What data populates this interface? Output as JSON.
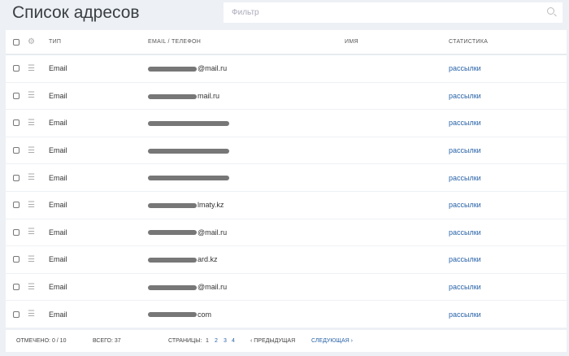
{
  "title": "Список адресов",
  "filter": {
    "placeholder": "Фильтр"
  },
  "columns": {
    "type": "ТИП",
    "email": "EMAIL / ТЕЛЕФОН",
    "name": "ИМЯ",
    "stats": "СТАТИСТИКА"
  },
  "rows": [
    {
      "type": "Email",
      "email": "@mail.ru",
      "stats": "рассылки"
    },
    {
      "type": "Email",
      "email": "mail.ru",
      "stats": "рассылки"
    },
    {
      "type": "Email",
      "email": "",
      "stats": "рассылки"
    },
    {
      "type": "Email",
      "email": "",
      "stats": "рассылки"
    },
    {
      "type": "Email",
      "email": "",
      "stats": "рассылки"
    },
    {
      "type": "Email",
      "email": "lmaty.kz",
      "stats": "рассылки"
    },
    {
      "type": "Email",
      "email": "@mail.ru",
      "stats": "рассылки"
    },
    {
      "type": "Email",
      "email": "ard.kz",
      "stats": "рассылки"
    },
    {
      "type": "Email",
      "email": "@mail.ru",
      "stats": "рассылки"
    },
    {
      "type": "Email",
      "email": "com",
      "stats": "рассылки"
    }
  ],
  "footer": {
    "selected": "ОТМЕЧЕНО: 0 / 10",
    "total_label": "ВСЕГО:",
    "total": "37",
    "pages_label": "СТРАНИЦЫ:",
    "pages": [
      "1",
      "2",
      "3",
      "4"
    ],
    "prev": "‹ ПРЕДЫДУЩАЯ",
    "next": "СЛЕДУЮЩАЯ ›"
  }
}
